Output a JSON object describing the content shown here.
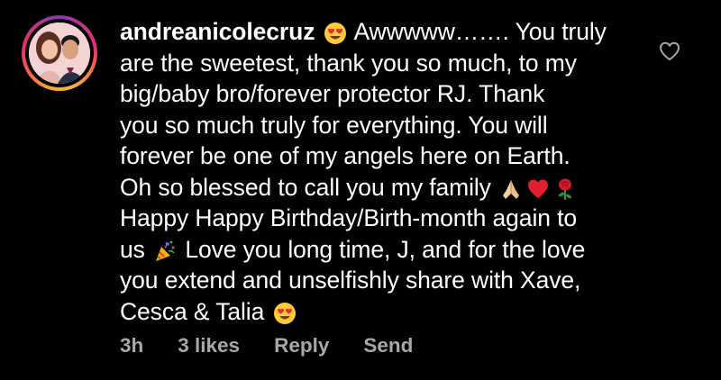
{
  "comment": {
    "username": "andreanicolecruz",
    "lines": [
      "Awwwww……. You truly",
      "are the sweetest, thank you so much, to my",
      "big/baby bro/forever protector RJ. Thank",
      "you so much truly for everything. You will",
      "forever be one of my angels here on Earth.",
      "Oh so blessed to call you my family",
      "Happy Happy Birthday/Birth-month again to",
      "us",
      "Love you long time, J, and for the love",
      "you extend and unselfishly share with Xave,",
      "Cesca & Talia"
    ],
    "emojis": [
      "heart-eyes-emoji",
      "folded-hands-emoji",
      "red-heart-emoji",
      "rose-emoji",
      "party-popper-emoji",
      "heart-eyes-emoji"
    ]
  },
  "meta": {
    "time": "3h",
    "likes": "3 likes",
    "reply_label": "Reply",
    "send_label": "Send"
  },
  "icons": {
    "like": "heart-outline-icon"
  },
  "colors": {
    "background": "#000000",
    "text": "#ffffff",
    "meta_text": "#a8a8a8",
    "story_ring": "#e1306c"
  }
}
